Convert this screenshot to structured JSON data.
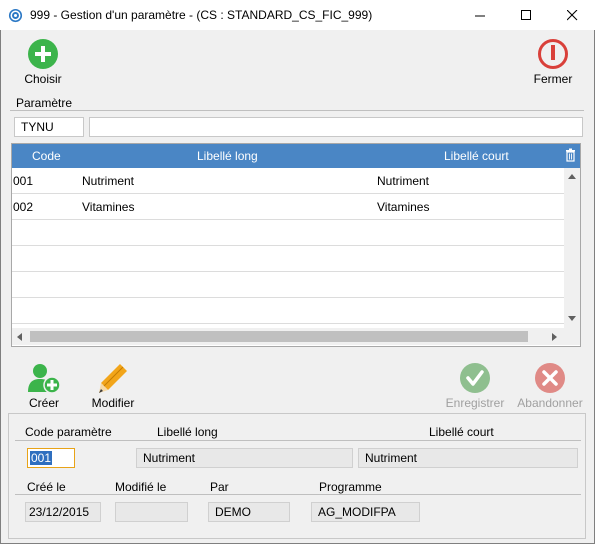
{
  "window": {
    "title": "999 - Gestion d'un paramètre - (CS : STANDARD_CS_FIC_999)"
  },
  "toolbar": {
    "choisir_label": "Choisir",
    "fermer_label": "Fermer"
  },
  "parametre": {
    "section_label": "Paramètre",
    "code_value": "TYNU",
    "description_value": ""
  },
  "grid": {
    "columns": [
      "Code",
      "Libellé long",
      "Libellé court"
    ],
    "rows": [
      {
        "code": "001",
        "libelle_long": "Nutriment",
        "libelle_court": "Nutriment"
      },
      {
        "code": "002",
        "libelle_long": "Vitamines",
        "libelle_court": "Vitamines"
      }
    ]
  },
  "actions": {
    "creer_label": "Créer",
    "modifier_label": "Modifier",
    "enregistrer_label": "Enregistrer",
    "abandonner_label": "Abandonner"
  },
  "detail": {
    "code_label": "Code paramètre",
    "libelle_long_label": "Libellé long",
    "libelle_court_label": "Libellé court",
    "code_value": "001",
    "libelle_long_value": "Nutriment",
    "libelle_court_value": "Nutriment",
    "cree_label": "Créé le",
    "modifie_label": "Modifié le",
    "par_label": "Par",
    "programme_label": "Programme",
    "cree_value": "23/12/2015",
    "modifie_value": "",
    "par_value": "DEMO",
    "programme_value": "AG_MODIFPA"
  },
  "colors": {
    "grid_header": "#4a86c5",
    "add_green": "#3cb44b",
    "close_red": "#d9403a",
    "disabled_green": "#8fbf8f",
    "disabled_red": "#e08a86",
    "pencil_orange": "#f2a51a"
  },
  "icons": {
    "app": "app-icon",
    "choisir": "plus-circle-icon",
    "fermer": "power-icon",
    "creer": "add-user-icon",
    "modifier": "pencil-icon",
    "enregistrer": "check-circle-icon",
    "abandonner": "x-circle-icon",
    "grid_corner": "trash-icon"
  }
}
